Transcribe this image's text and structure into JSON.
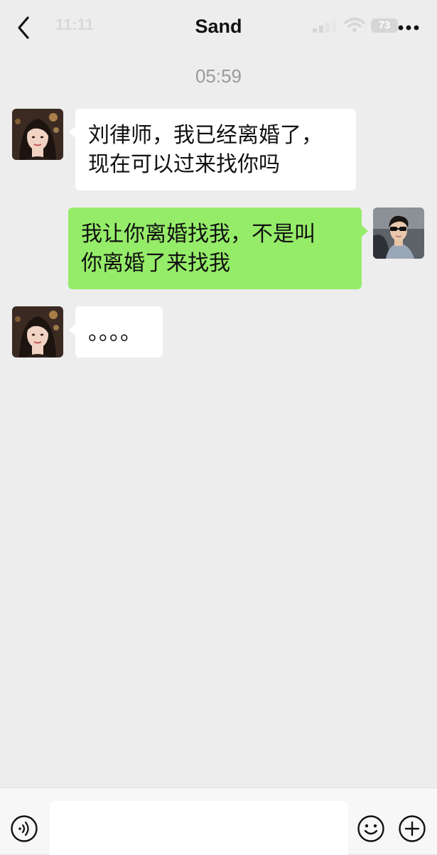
{
  "status_bar": {
    "time": "11:11",
    "battery": "73"
  },
  "header": {
    "title": "Sand"
  },
  "chat": {
    "timestamp": "05:59",
    "messages": [
      {
        "side": "left",
        "sender": "contact",
        "lines": [
          "刘律师，我已经离婚了，",
          "现在可以过来找你吗"
        ]
      },
      {
        "side": "right",
        "sender": "me",
        "lines": [
          "我让你离婚找我，不是叫",
          "你离婚了来找我"
        ]
      },
      {
        "side": "left",
        "sender": "contact",
        "lines": [
          "。。。。"
        ]
      }
    ]
  },
  "composer": {
    "input_value": "",
    "icons": [
      "voice-icon",
      "emoji-icon",
      "plus-icon"
    ]
  },
  "colors": {
    "background": "#ededed",
    "incoming_bubble": "#ffffff",
    "outgoing_bubble": "#95ec69",
    "timestamp": "#9a9a9a"
  }
}
